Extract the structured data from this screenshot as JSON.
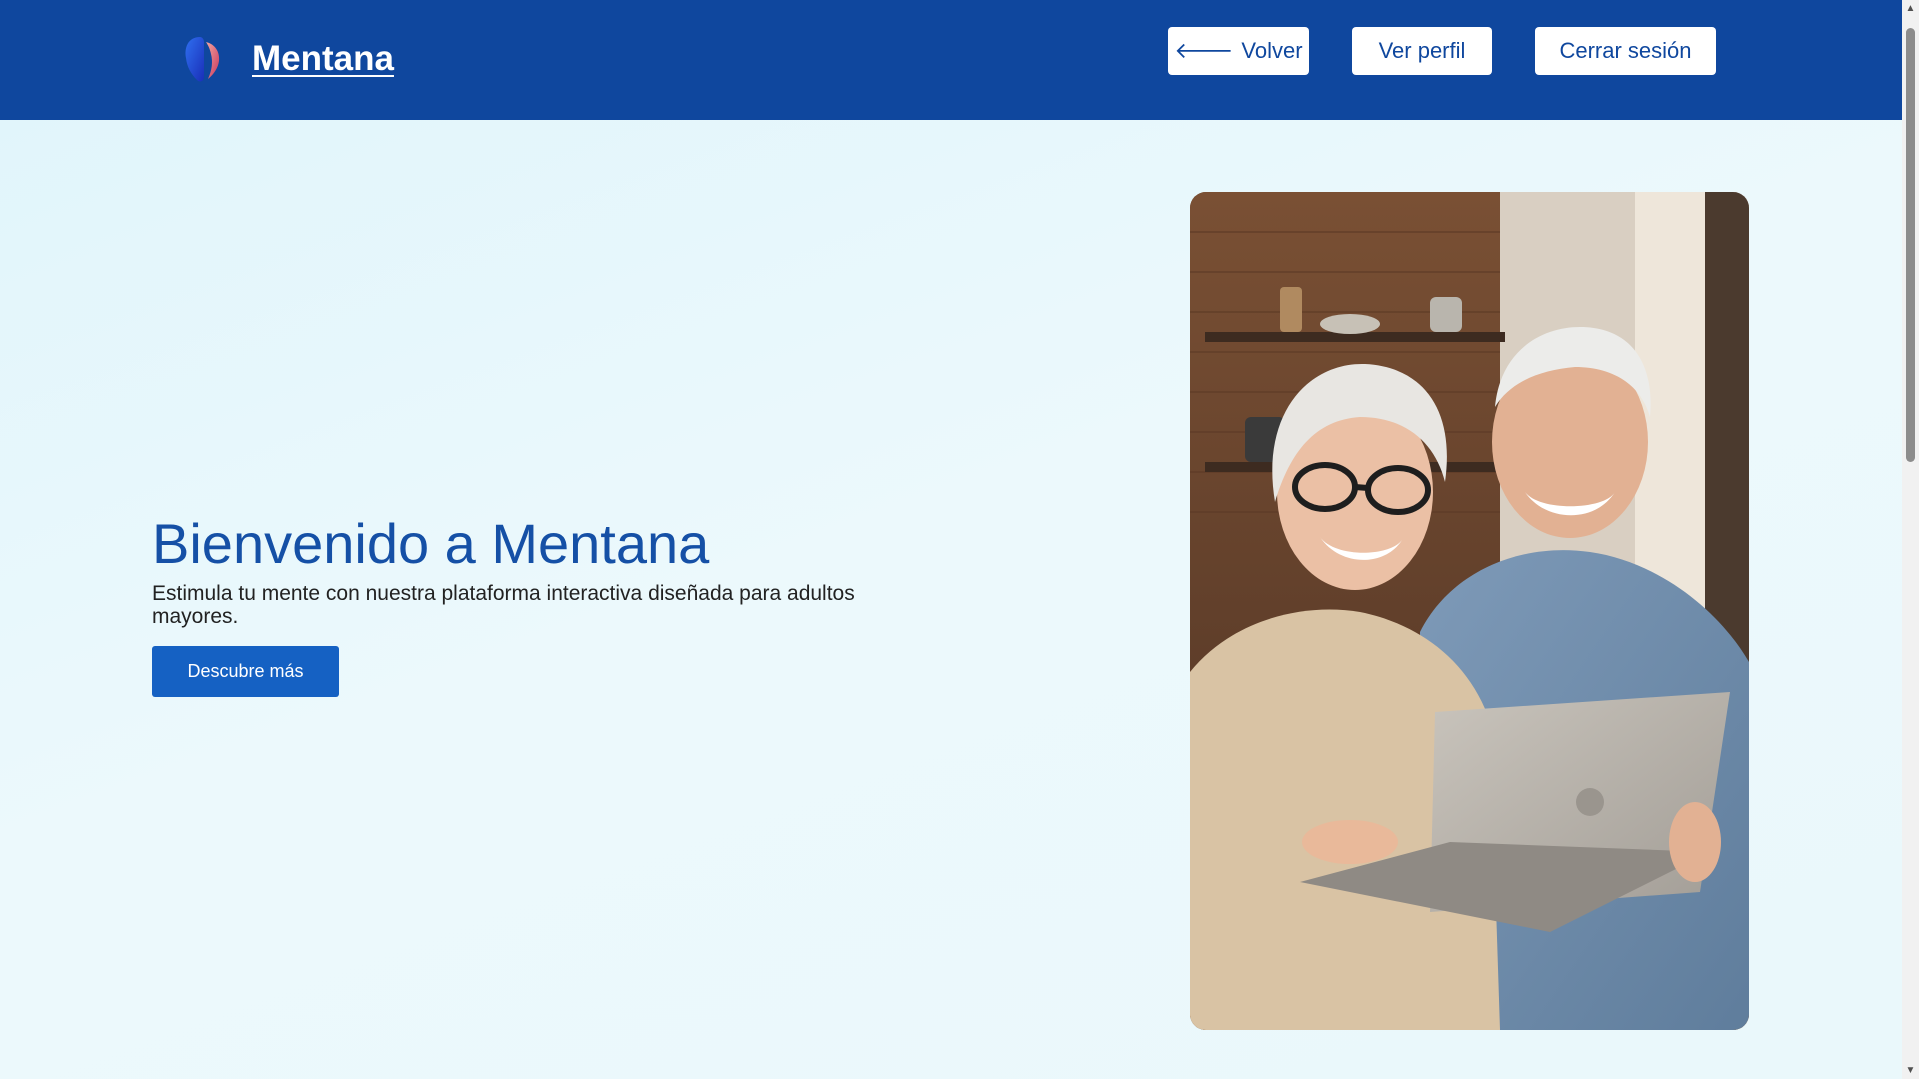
{
  "header": {
    "brand_name": "Mentana",
    "buttons": {
      "back_arrow": "🡐",
      "back_label": "Volver",
      "profile_label": "Ver perfil",
      "logout_label": "Cerrar sesión"
    }
  },
  "hero": {
    "title": "Bienvenido a Mentana",
    "subtitle": "Estimula tu mente con nuestra plataforma interactiva diseñada para adultos mayores.",
    "cta_label": "Descubre más",
    "image_subject": "senior couple smiling at a laptop"
  },
  "colors": {
    "header_bg": "#0f479e",
    "title": "#1550a6",
    "cta_bg": "#1561c3",
    "page_bg": "#eaf8fb"
  },
  "icons": [
    "brain-logo-icon",
    "arrow-left-icon",
    "chevron-up-icon",
    "chevron-down-icon"
  ]
}
